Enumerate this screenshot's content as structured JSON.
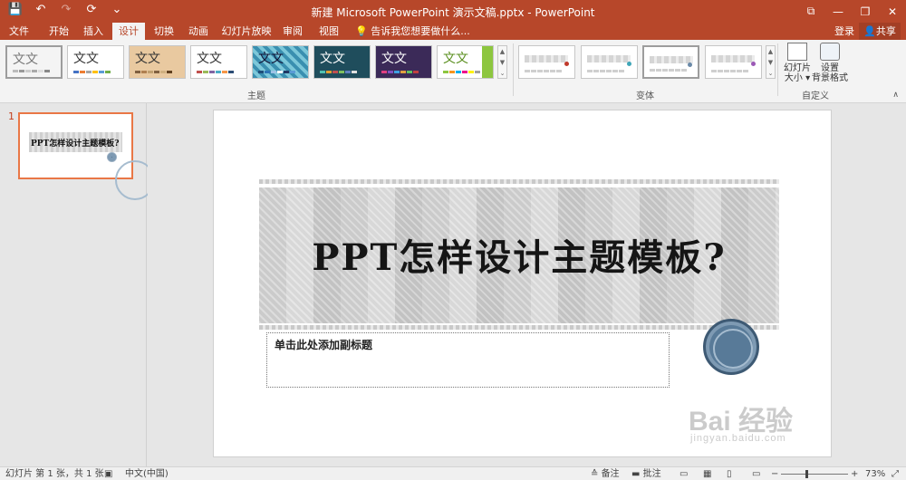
{
  "window": {
    "title": "新建 Microsoft PowerPoint 演示文稿.pptx - PowerPoint",
    "qat": [
      "💾",
      "↶",
      "↷",
      "⟳",
      "⌄"
    ],
    "controls": [
      "⧉",
      "—",
      "❐",
      "✕"
    ]
  },
  "tabs": [
    "文件",
    "开始",
    "插入",
    "设计",
    "切换",
    "动画",
    "幻灯片放映",
    "审阅",
    "视图"
  ],
  "active_tab": "设计",
  "tell_me": "告诉我您想要做什么...",
  "login": "登录",
  "share": "共享",
  "ribbon": {
    "themes_label": "主题",
    "variants_label": "变体",
    "customize_label": "自定义",
    "theme_sample_text": "文文",
    "slide_size": {
      "line1": "幻灯片",
      "line2": "大小 ▾"
    },
    "format_bg": {
      "line1": "设置",
      "line2": "背景格式"
    }
  },
  "thumbnail": {
    "number": "1",
    "title": "PPT怎样设计主题模板?"
  },
  "slide": {
    "title": "PPT怎样设计主题模板?",
    "subtitle_placeholder": "单击此处添加副标题"
  },
  "watermark": {
    "brand": "Bai 经验",
    "url": "jingyan.baidu.com"
  },
  "status": {
    "slide_info": "幻灯片 第 1 张，共 1 张",
    "language": "中文(中国)",
    "notes": "备注",
    "comments": "批注",
    "zoom": "73%",
    "minus": "−",
    "plus": "+"
  },
  "colors": {
    "accent": "#b7472a",
    "selected_thumb_border": "#e97746"
  }
}
